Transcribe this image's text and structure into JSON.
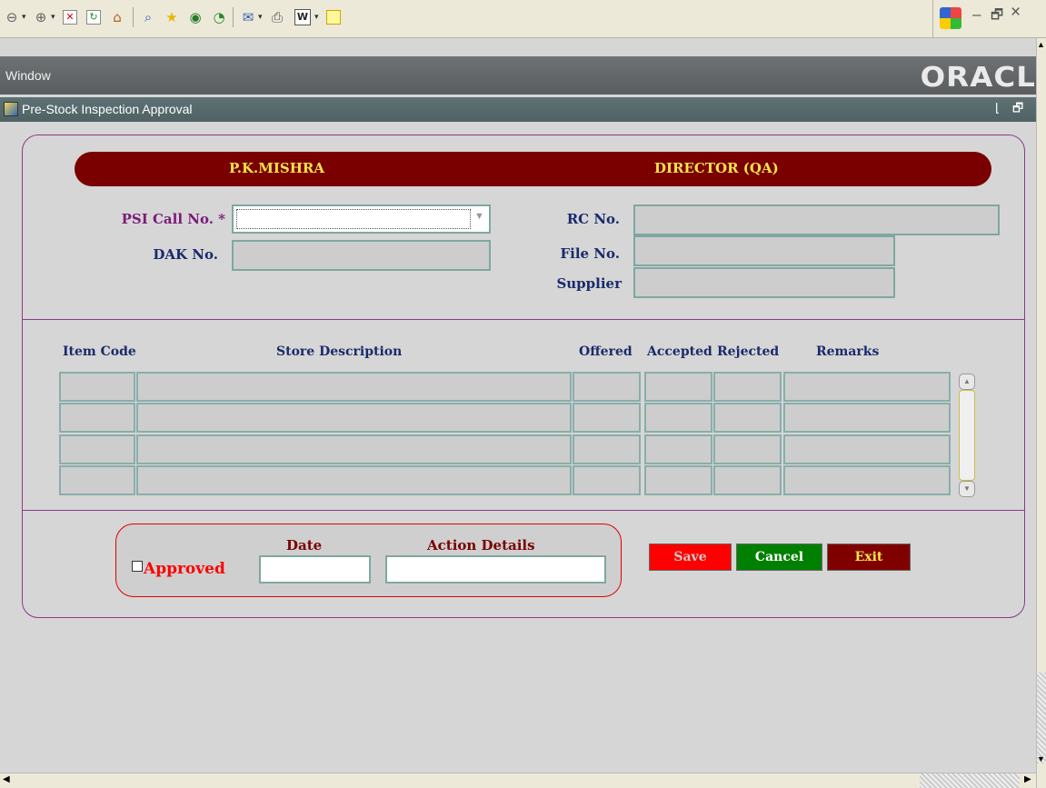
{
  "toolbar": {
    "icons": [
      "back-icon",
      "forward-icon",
      "stop-icon",
      "refresh-icon",
      "home-icon",
      "search-icon",
      "favorites-icon",
      "media-icon",
      "history-icon",
      "mail-icon",
      "print-icon",
      "edit-icon",
      "discuss-icon"
    ]
  },
  "window_controls": {
    "minimize": "–",
    "restore": "🗗",
    "close": "×"
  },
  "oracle": {
    "window_menu": "Window",
    "logo": "ORACL"
  },
  "form": {
    "title": "Pre-Stock Inspection Approval"
  },
  "banner": {
    "name": "P.K.MISHRA",
    "designation": "DIRECTOR (QA)"
  },
  "fields": {
    "psi_call_label": "PSI Call No. *",
    "dak_label": "DAK No.",
    "rc_label": "RC No.",
    "file_label": "File No.",
    "supplier_label": "Supplier"
  },
  "table": {
    "headers": [
      "Item Code",
      "Store Description",
      "Offered",
      "Accepted",
      "Rejected",
      "Remarks"
    ]
  },
  "approval": {
    "checkbox_label": "Approved",
    "date_label": "Date",
    "action_label": "Action Details"
  },
  "buttons": {
    "save": "Save",
    "cancel": "Cancel",
    "exit": "Exit"
  },
  "colors": {
    "banner": "#7a0000",
    "banner_text": "#f6e34b",
    "save": "#ff0000",
    "cancel": "#008000",
    "exit": "#800000",
    "approved_text": "#ff0000"
  }
}
